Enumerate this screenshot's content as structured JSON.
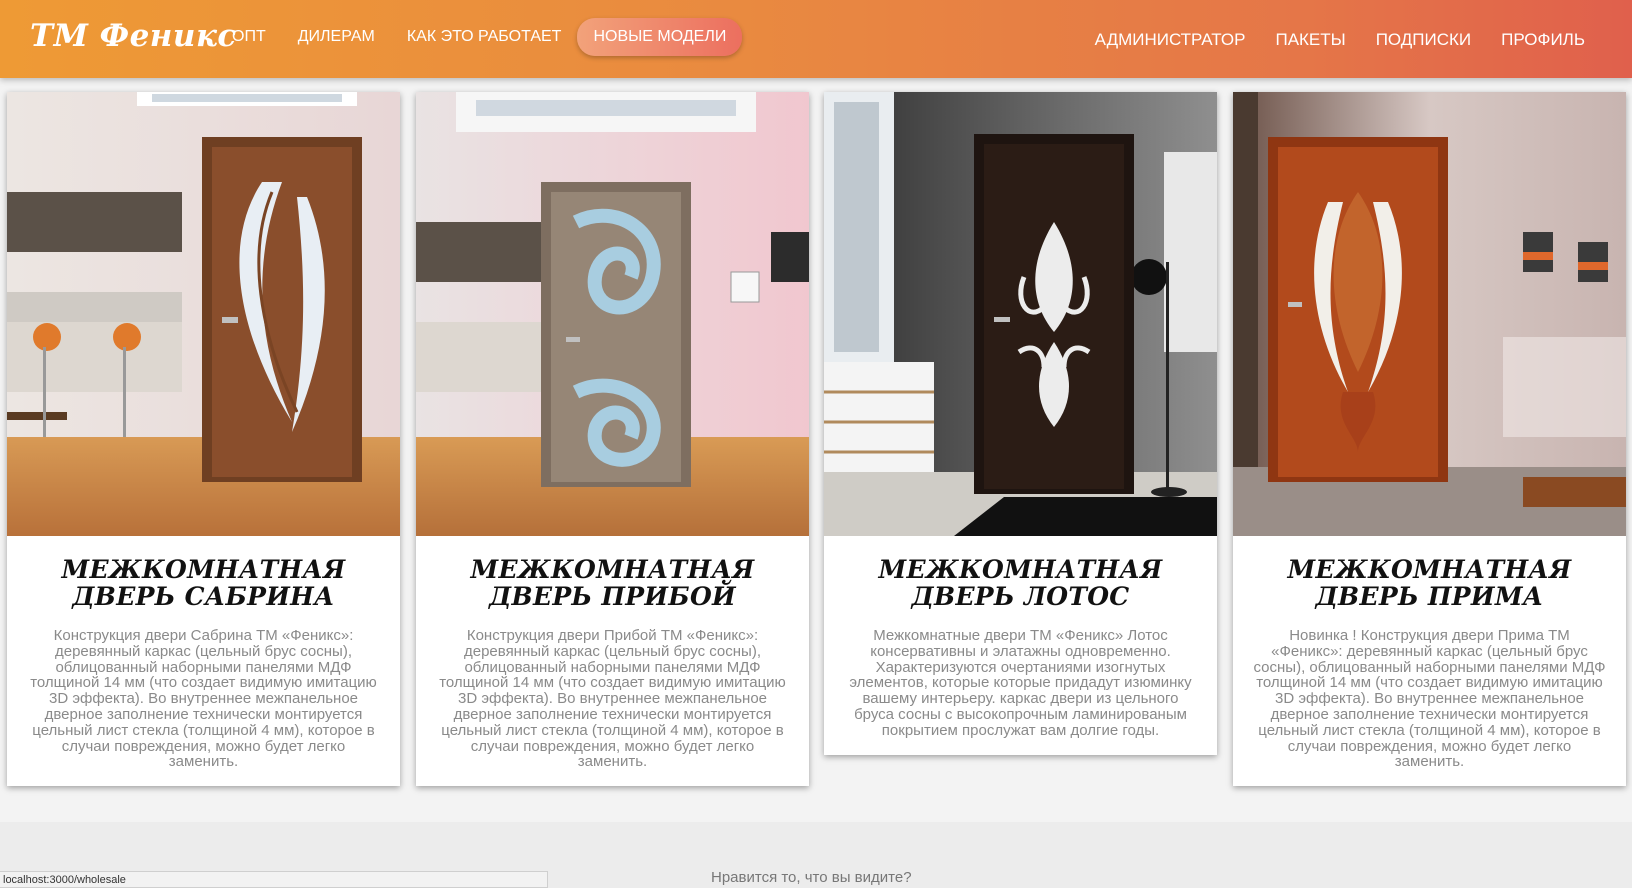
{
  "nav": {
    "logo": "ТМ Феникс",
    "left": [
      "ОПТ",
      "ДИЛЕРАМ",
      "КАК ЭТО РАБОТАЕТ",
      "НОВЫЕ МОДЕЛИ"
    ],
    "right": [
      "АДМИНИСТРАТОР",
      "ПАКЕТЫ",
      "ПОДПИСКИ",
      "ПРОФИЛЬ"
    ],
    "active_item": "НОВЫЕ МОДЕЛИ",
    "colors": {
      "gradient_start": "#ee9a35",
      "gradient_end": "#e0604c"
    }
  },
  "cards": [
    {
      "title": "МЕЖКОМНАТНАЯ ДВЕРЬ САБРИНА",
      "text": "Конструкция двери Сабрина ТМ «Феникс»: деревянный каркас (цельный брус сосны), облицованный наборными панелями МДФ толщиной 14 мм (что создает видимую имитацию 3D эффекта). Во внутреннее межпанельное дверное заполнение технически монтируется цельный лист стекла (толщиной 4 мм), которое в случаи повреждения, можно будет легко заменить.",
      "door_color": "#8a4e2c"
    },
    {
      "title": "МЕЖКОМНАТНАЯ ДВЕРЬ ПРИБОЙ",
      "text": "Конструкция двери Прибой ТМ «Феникс»: деревянный каркас (цельный брус сосны), облицованный наборными панелями МДФ толщиной 14 мм (что создает видимую имитацию 3D эффекта). Во внутреннее межпанельное дверное заполнение технически монтируется цельный лист стекла (толщиной 4 мм), которое в случаи повреждения, можно будет легко заменить.",
      "door_color": "#8c7c6c"
    },
    {
      "title": "МЕЖКОМНАТНАЯ ДВЕРЬ ЛОТОС",
      "text": "Межкомнатные двери ТМ «Феникс» Лотос консервативны и элатажны одновременно. Характеризуются очертаниями изогнутых элементов, которые которые придадут изюминку вашему интерьеру. каркас двери из цельного бруса сосны с высокопрочным ламинированым покрытием прослужат вам долгие годы.",
      "door_color": "#2b1c15"
    },
    {
      "title": "МЕЖКОМНАТНАЯ ДВЕРЬ ПРИМА",
      "text": "Новинка ! Конструкция двери Прима ТМ «Феникс»: деревянный каркас (цельный брус сосны), облицованный наборными панелями МДФ толщиной 14 мм (что создает видимую имитацию 3D эффекта). Во внутреннее межпанельное дверное заполнение технически монтируется цельный лист стекла (толщиной 4 мм), которое в случаи повреждения, можно будет легко заменить.",
      "door_color": "#b24a1c"
    }
  ],
  "footer": {
    "text": "Нравится то, что вы видите?"
  },
  "status_url": "localhost:3000/wholesale"
}
